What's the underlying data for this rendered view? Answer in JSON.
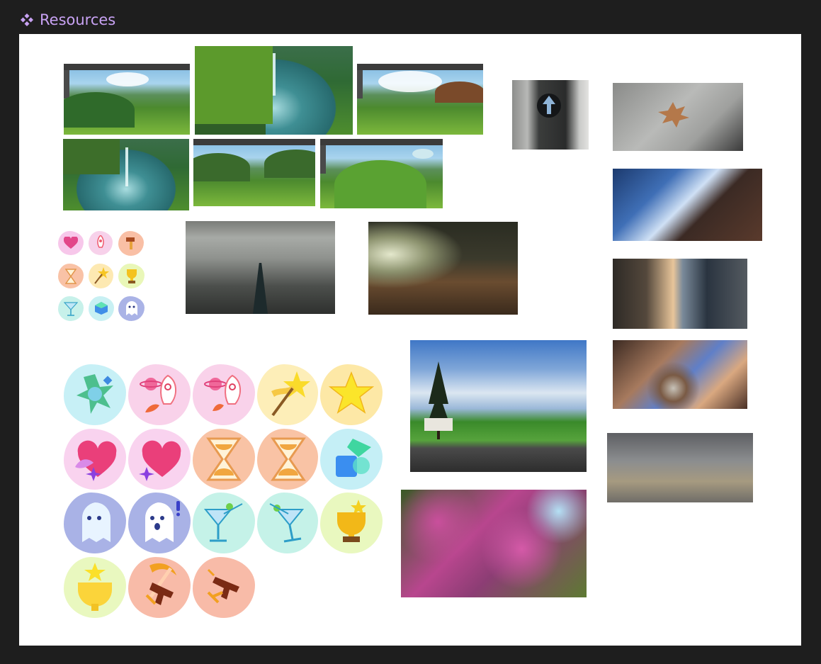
{
  "frame": {
    "title": "Resources",
    "icon": "component-icon",
    "title_color": "#c8a2f3",
    "background_color": "#1e1e1e",
    "canvas_color": "#ffffff"
  },
  "images": {
    "game_screenshots": [
      "game-screenshot",
      "game-lake-screenshot",
      "game-screenshot",
      "game-lake-screenshot",
      "game-screenshot",
      "game-screenshot"
    ],
    "renders": [
      "train-interior-render",
      "classroom-render"
    ],
    "photos": [
      "pedestrian-button-photo",
      "dry-leaf-photo",
      "towers-looking-up-photo",
      "glass-towers-photo",
      "blossom-tree-photo",
      "atrium-photo",
      "park-sky-photo",
      "redbud-blossom-photo"
    ]
  },
  "icon_sets": {
    "small": [
      "heart-icon",
      "rocket-icon",
      "hammer-icon",
      "hourglass-icon",
      "magic-wand-icon",
      "trophy-icon",
      "cocktail-icon",
      "cube-icon",
      "ghost-icon"
    ],
    "large": [
      "gem-icon",
      "rocket-icon",
      "rocket-icon",
      "magic-wand-icon",
      "star-icon",
      "heart-icon",
      "heart-icon",
      "hourglass-icon",
      "hourglass-icon",
      "cube-icon",
      "ghost-icon",
      "ghost-icon",
      "cocktail-icon",
      "cocktail-icon",
      "trophy-icon",
      "trophy-icon",
      "sickle-gun-icon",
      "gun-icon"
    ]
  }
}
